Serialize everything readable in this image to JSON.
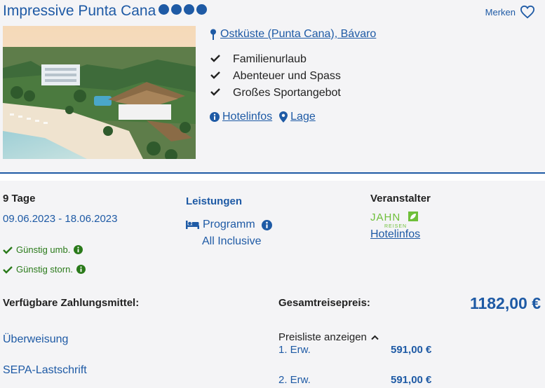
{
  "hotel": {
    "name": "Impressive Punta Cana",
    "stars": 4,
    "save_label": "Merken",
    "location": "Ostküste (Punta Cana), Bávaro",
    "features": [
      "Familienurlaub",
      "Abenteuer und Spass",
      "Großes Sportangebot"
    ],
    "hotelinfos_label": "Hotelinfos",
    "lage_label": "Lage"
  },
  "offer": {
    "duration": "9 Tage",
    "dates": "09.06.2023 - 18.06.2023",
    "perks": [
      "Günstig umb.",
      "Günstig storn."
    ],
    "services_title": "Leistungen",
    "program_label": "Programm",
    "board": "All Inclusive",
    "operator_title": "Veranstalter",
    "operator_logo_text": "JAHN",
    "operator_logo_sub": "REISEN",
    "operator_link": "Hotelinfos"
  },
  "payment": {
    "title": "Verfügbare Zahlungsmittel:",
    "methods": [
      "Überweisung",
      "SEPA-Lastschrift"
    ]
  },
  "price": {
    "total_label": "Gesamtreisepreis:",
    "total": "1182,00 €",
    "pricelist_label": "Preisliste anzeigen",
    "rows": [
      {
        "label": "1. Erw.",
        "amount": "591,00 €"
      },
      {
        "label": "2. Erw.",
        "amount": "591,00 €"
      }
    ]
  },
  "colors": {
    "accent": "#1e5aa5",
    "positive": "#2a7a1a",
    "operator": "#6fbf3a"
  }
}
